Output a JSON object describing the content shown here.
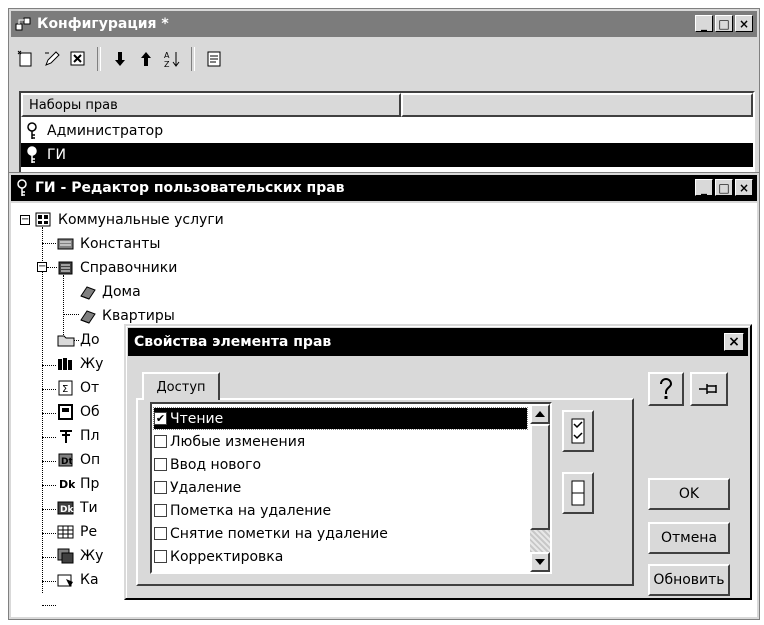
{
  "config_window": {
    "title": "Конфигурация *",
    "column_header": "Наборы прав",
    "rights_sets": [
      "Администратор",
      "ГИ"
    ]
  },
  "editor_window": {
    "title": "ГИ - Редактор пользовательских прав",
    "tree": {
      "root": "Коммунальные услуги",
      "items": [
        {
          "label": "Константы"
        },
        {
          "label": "Справочники"
        },
        {
          "label": "Дома"
        },
        {
          "label": "Квартиры"
        },
        {
          "label": "До"
        },
        {
          "label": "Жу"
        },
        {
          "label": "От"
        },
        {
          "label": "Об"
        },
        {
          "label": "Пл"
        },
        {
          "label": "Оп"
        },
        {
          "label": "Пр"
        },
        {
          "label": "Ти"
        },
        {
          "label": "Ре"
        },
        {
          "label": "Жу"
        },
        {
          "label": "Ка"
        }
      ]
    }
  },
  "dialog": {
    "title": "Свойства элемента прав",
    "tab": "Доступ",
    "permissions": [
      {
        "label": "Чтение",
        "checked": true,
        "selected": true
      },
      {
        "label": "Любые изменения",
        "checked": false
      },
      {
        "label": "Ввод нового",
        "checked": false
      },
      {
        "label": "Удаление",
        "checked": false
      },
      {
        "label": "Пометка на удаление",
        "checked": false
      },
      {
        "label": "Снятие пометки на удаление",
        "checked": false
      },
      {
        "label": "Корректировка",
        "checked": false
      }
    ],
    "ok": "OK",
    "cancel": "Отмена",
    "refresh": "Обновить",
    "close_glyph": "×"
  },
  "window_buttons": {
    "minimize": "_",
    "maximize": "□",
    "close": "×"
  }
}
